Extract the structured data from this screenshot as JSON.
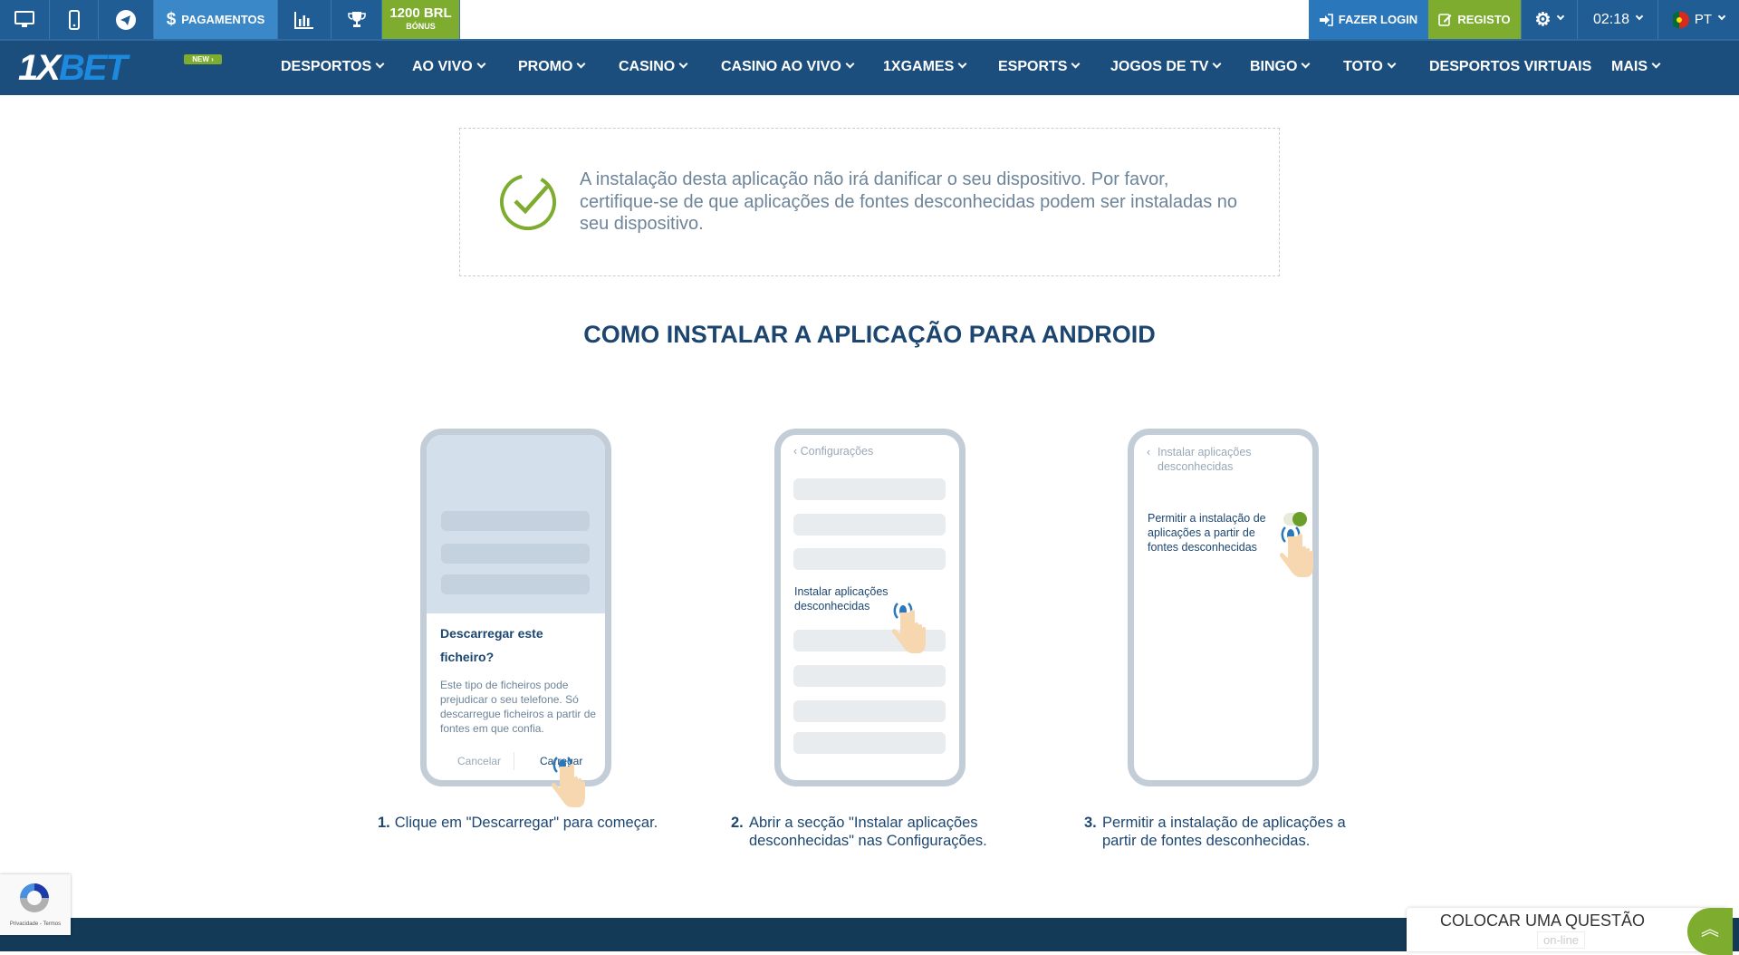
{
  "topbar": {
    "items": [
      {
        "icon": "desktop-icon"
      },
      {
        "icon": "mobile-icon"
      },
      {
        "icon": "telegram-icon"
      },
      {
        "icon": "dollar-icon",
        "label": "PAGAMENTOS"
      },
      {
        "icon": "stats-icon"
      },
      {
        "icon": "trophy-icon"
      }
    ],
    "bonus": {
      "amount": "1200 BRL",
      "label": "BÓNUS"
    },
    "login": "FAZER LOGIN",
    "register": "REGISTO",
    "time": "02:18",
    "language": "PT"
  },
  "nav": {
    "logo": "1XBET",
    "new_badge": "NEW ›",
    "items": [
      {
        "label": "DESPORTOS",
        "dropdown": true
      },
      {
        "label": "AO VIVO",
        "dropdown": true
      },
      {
        "label": "PROMO",
        "dropdown": true
      },
      {
        "label": "CASINO",
        "dropdown": true
      },
      {
        "label": "CASINO AO VIVO",
        "dropdown": true
      },
      {
        "label": "1XGAMES",
        "dropdown": true
      },
      {
        "label": "ESPORTS",
        "dropdown": true
      },
      {
        "label": "JOGOS DE TV",
        "dropdown": true
      },
      {
        "label": "BINGO",
        "dropdown": true
      },
      {
        "label": "TOTO",
        "dropdown": true
      },
      {
        "label": "DESPORTOS VIRTUAIS",
        "dropdown": false
      },
      {
        "label": "MAIS",
        "dropdown": true
      }
    ]
  },
  "notice": {
    "text": "A instalação desta aplicação não irá danificar o seu dispositivo. Por favor, certifique-se de que aplicações de fontes desconhecidas podem ser instaladas no seu dispositivo."
  },
  "heading": "COMO INSTALAR A APLICAÇÃO PARA ANDROID",
  "steps": [
    {
      "num": "1.",
      "caption": "Clique em \"Descarregar\" para começar.",
      "phone": {
        "title": "Descarregar este ficheiro?",
        "body": "Este tipo de ficheiros pode prejudicar o seu telefone. Só descarregue ficheiros a partir de fontes em que confia.",
        "cancel": "Cancelar",
        "confirm": "Carregar"
      }
    },
    {
      "num": "2.",
      "caption": "Abrir a secção \"Instalar aplicações desconhecidas\" nas Configurações.",
      "phone": {
        "header": "Configurações",
        "item": "Instalar aplicações desconhecidas"
      }
    },
    {
      "num": "3.",
      "caption": "Permitir a instalação de aplicações a partir de fontes desconhecidas.",
      "phone": {
        "header": "Instalar aplicações desconhecidas",
        "setting": "Permitir a instalação de aplicações a partir de fontes desconhecidas",
        "toggle_on": true
      }
    }
  ],
  "recaptcha": {
    "text": "Privacidade - Termos"
  },
  "chat": {
    "label": "COLOCAR UMA QUESTÃO",
    "status": "on-line"
  },
  "colors": {
    "nav": "#1b4e7d",
    "topbar": "#1f5d94",
    "green": "#7dac2e",
    "heading": "#1c4670",
    "footer": "#133a57"
  }
}
